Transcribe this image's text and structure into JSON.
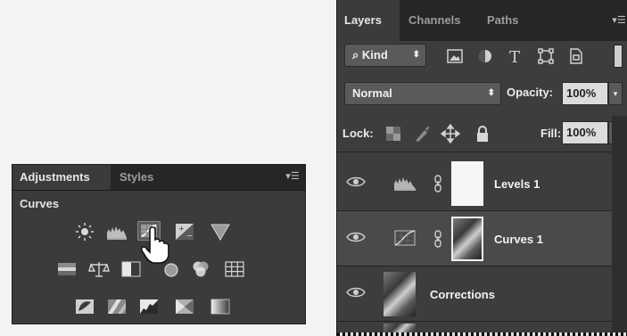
{
  "adjustments_panel": {
    "tabs": [
      {
        "label": "Adjustments",
        "active": true
      },
      {
        "label": "Styles",
        "active": false
      }
    ],
    "menu_icon": "panel-menu-icon",
    "heading": "Curves",
    "icons_row1": [
      "brightness-contrast-icon",
      "levels-icon",
      "curves-icon",
      "exposure-icon",
      "vibrance-icon"
    ],
    "icons_row2": [
      "hue-saturation-icon",
      "color-balance-icon",
      "black-white-icon",
      "photo-filter-icon",
      "channel-mixer-icon",
      "color-lookup-icon"
    ],
    "icons_row3": [
      "invert-icon",
      "posterize-icon",
      "threshold-icon",
      "selective-color-icon",
      "gradient-map-icon"
    ],
    "selected_icon": "curves-icon"
  },
  "layers_panel": {
    "tabs": [
      {
        "label": "Layers",
        "active": true
      },
      {
        "label": "Channels",
        "active": false
      },
      {
        "label": "Paths",
        "active": false
      }
    ],
    "filter_kind": "Kind",
    "filter_icons": [
      "pixel-filter-icon",
      "adjustment-filter-icon",
      "type-filter-icon",
      "shape-filter-icon",
      "smart-object-filter-icon"
    ],
    "blend_mode": "Normal",
    "opacity_label": "Opacity:",
    "opacity_value": "100%",
    "lock_label": "Lock:",
    "lock_icons": [
      "lock-transparent-icon",
      "lock-image-icon",
      "lock-position-icon",
      "lock-all-icon"
    ],
    "fill_label": "Fill:",
    "fill_value": "100%",
    "layers": [
      {
        "name": "Levels 1",
        "type": "adjustment",
        "adj_icon": "levels-icon",
        "visible": true,
        "selected": false
      },
      {
        "name": "Curves 1",
        "type": "adjustment",
        "adj_icon": "curves-icon",
        "visible": true,
        "selected": true
      },
      {
        "name": "Corrections",
        "type": "pixel",
        "visible": true,
        "selected": false
      }
    ]
  },
  "colors": {
    "panel_bg": "#3b3b3b",
    "tab_bar_bg": "#262626",
    "selected_row_bg": "#4a4a4a",
    "text": "#ececec"
  }
}
